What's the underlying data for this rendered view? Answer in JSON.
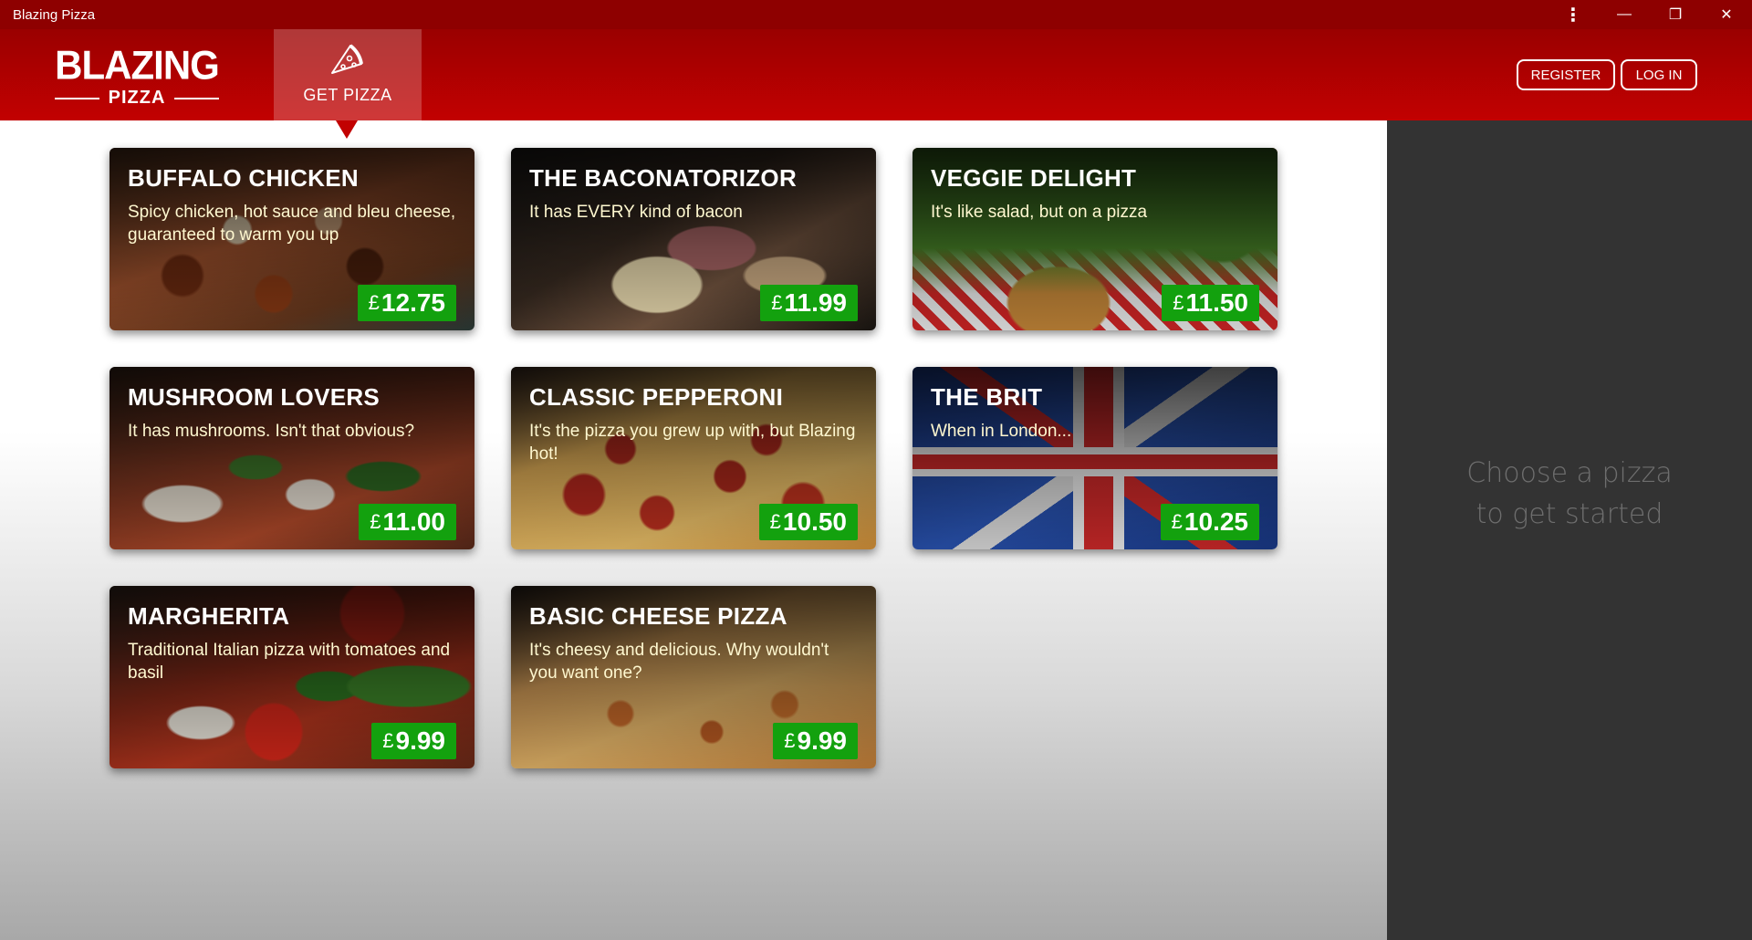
{
  "window": {
    "title": "Blazing Pizza"
  },
  "header": {
    "logo_top": "BLAZING",
    "logo_bottom": "PIZZA",
    "nav_get_pizza": "GET PIZZA",
    "register_label": "REGISTER",
    "login_label": "LOG IN"
  },
  "sidebar": {
    "line1": "Choose a pizza",
    "line2": "to get started"
  },
  "currency_symbol": "£",
  "pizzas": [
    {
      "name": "BUFFALO CHICKEN",
      "description": "Spicy chicken, hot sauce and bleu cheese, guaranteed to warm you up",
      "price": "12.75"
    },
    {
      "name": "THE BACONATORIZOR",
      "description": "It has EVERY kind of bacon",
      "price": "11.99"
    },
    {
      "name": "VEGGIE DELIGHT",
      "description": "It's like salad, but on a pizza",
      "price": "11.50"
    },
    {
      "name": "MUSHROOM LOVERS",
      "description": "It has mushrooms. Isn't that obvious?",
      "price": "11.00"
    },
    {
      "name": "CLASSIC PEPPERONI",
      "description": "It's the pizza you grew up with, but Blazing hot!",
      "price": "10.50"
    },
    {
      "name": "THE BRIT",
      "description": "When in London...",
      "price": "10.25"
    },
    {
      "name": "MARGHERITA",
      "description": "Traditional Italian pizza with tomatoes and basil",
      "price": "9.99"
    },
    {
      "name": "BASIC CHEESE PIZZA",
      "description": "It's cheesy and delicious. Why wouldn't you want one?",
      "price": "9.99"
    }
  ],
  "colors": {
    "header_red": "#c20101",
    "price_green": "#13a10e",
    "sidebar_bg": "#333333"
  },
  "icons": {
    "nav_get_pizza_icon": "pizza-slice-icon",
    "window_more": "more-vertical-icon",
    "window_minimize": "minimize-icon",
    "window_restore": "restore-icon",
    "window_close": "close-icon"
  }
}
